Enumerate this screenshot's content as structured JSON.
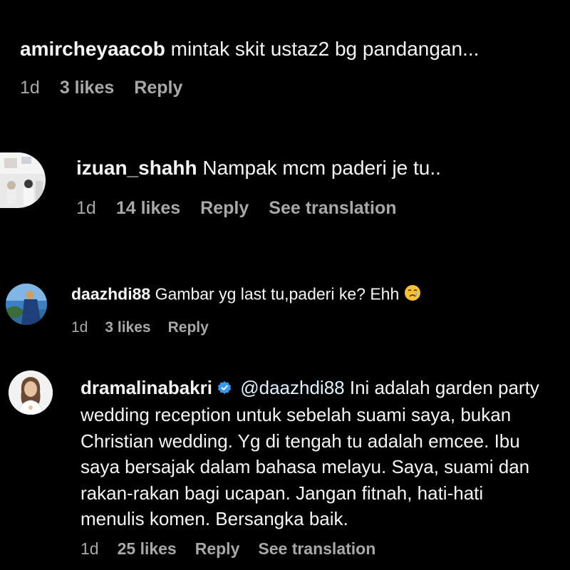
{
  "comments": [
    {
      "username": "amircheyaacob",
      "text": "mintak skit ustaz2 bg pandangan...",
      "time": "1d",
      "likes": "3 likes",
      "reply": "Reply"
    },
    {
      "username": "izuan_shahh",
      "text": "Nampak mcm paderi je tu..",
      "time": "1d",
      "likes": "14 likes",
      "reply": "Reply",
      "translate": "See translation"
    },
    {
      "username": "daazhdi88",
      "text": "Gambar yg last tu,paderi ke? Ehh",
      "emoji": "crying-face-emoji",
      "time": "1d",
      "likes": "3 likes",
      "reply": "Reply"
    },
    {
      "username": "dramalinabakri",
      "verified": true,
      "mention": "@daazhdi88",
      "text": "Ini adalah garden party wedding reception untuk sebelah suami saya, bukan Christian wedding. Yg di tengah tu adalah emcee. Ibu saya bersajak dalam bahasa melayu. Saya, suami dan rakan-rakan bagi ucapan. Jangan fitnah, hati-hati menulis komen. Bersangka baik.",
      "time": "1d",
      "likes": "25 likes",
      "reply": "Reply",
      "translate": "See translation"
    }
  ],
  "colors": {
    "background": "#000000",
    "text": "#f5f5f5",
    "meta": "#a8a8a8",
    "verified": "#3897f0"
  }
}
